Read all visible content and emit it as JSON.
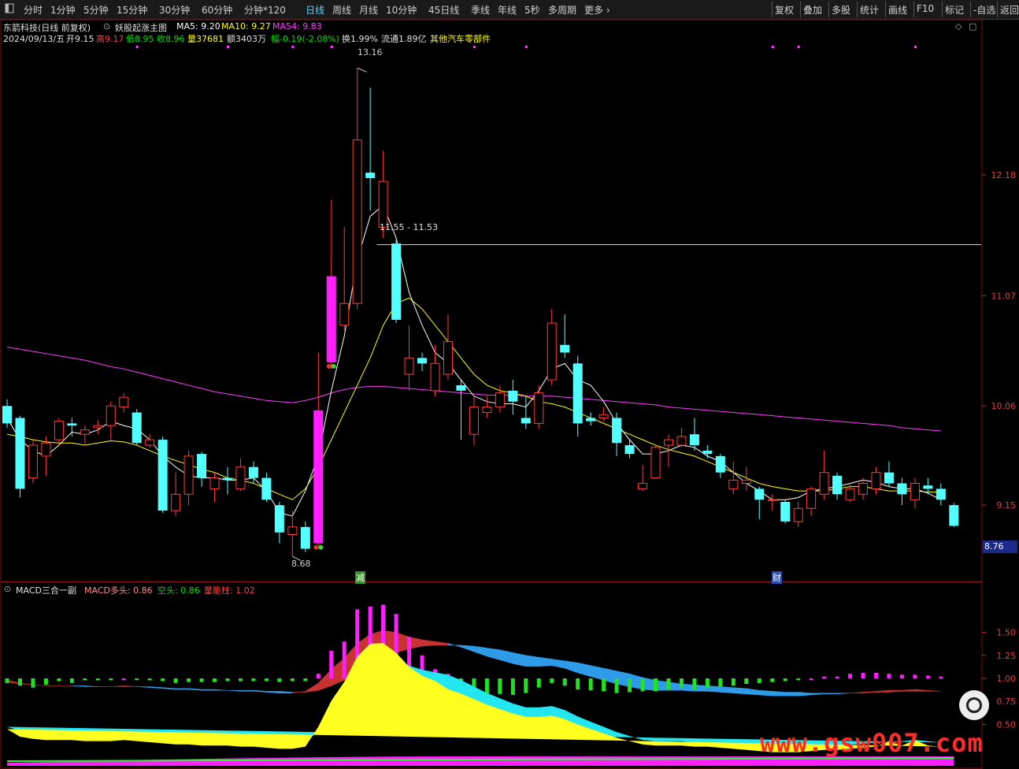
{
  "toolbar": {
    "left_icon": "panel-toggle-icon",
    "periods": [
      "分时",
      "1分钟",
      "5分钟",
      "15分钟",
      "30分钟",
      "60分钟",
      "分钟*120",
      "日线",
      "周线",
      "月线",
      "10分钟",
      "45日线",
      "季线",
      "年线",
      "5秒",
      "多周期",
      "更多"
    ],
    "active_period": "日线",
    "right": [
      "复权",
      "叠加",
      "多股",
      "统计",
      "画线",
      "F10",
      "标记",
      "-自选",
      "返回"
    ]
  },
  "header": {
    "stock": "东箭科技(日线 前复权)",
    "indicator_name": "妖股起涨主图",
    "ma5": "MA5: 9.20",
    "ma10": "MA10: 9.27",
    "ma54": "MA54: 9.83",
    "date": "2024/09/13/五",
    "open": "开9.15",
    "high": "高9.17",
    "low": "低8.95",
    "close": "收8.96",
    "vol": "量37681",
    "amount": "额3403万",
    "change": "幅-0.19(-2.08%)",
    "turnover": "换1.99%",
    "float": "流通1.89亿",
    "sector": "其他汽车零部件"
  },
  "price_labels": {
    "high": "13.16",
    "low": "8.68",
    "range": "11.55 - 11.53",
    "current": "8.76"
  },
  "markers": {
    "jian": "减",
    "cai": "财"
  },
  "sub_header": {
    "name": "MACD三合一副",
    "duo": "MACD多头: 0.86",
    "kong": "空头: 0.86",
    "liang": "量能柱: 1.02"
  },
  "colors": {
    "up": "#ff3c3c",
    "down": "#54ffff",
    "ma5": "#ffffff",
    "ma10": "#ffff00",
    "ma54": "#ff3cff"
  },
  "chart_data": [
    {
      "type": "candlestick",
      "title": "东箭科技(日线 前复权)",
      "y_ticks": [
        12.18,
        11.07,
        10.06,
        9.15
      ],
      "ylim": [
        8.45,
        13.35
      ],
      "candles": [
        [
          10.06,
          9.9,
          10.12,
          9.86
        ],
        [
          9.95,
          9.3,
          9.97,
          9.22
        ],
        [
          9.4,
          9.7,
          9.75,
          9.35
        ],
        [
          9.6,
          9.72,
          9.78,
          9.42
        ],
        [
          9.75,
          9.92,
          9.95,
          9.7
        ],
        [
          9.9,
          9.88,
          9.95,
          9.78
        ],
        [
          9.8,
          9.84,
          9.88,
          9.7
        ],
        [
          9.86,
          9.88,
          9.93,
          9.8
        ],
        [
          9.88,
          10.06,
          10.1,
          9.75
        ],
        [
          10.05,
          10.14,
          10.18,
          10.0
        ],
        [
          10.0,
          9.72,
          10.03,
          9.7
        ],
        [
          9.7,
          9.75,
          9.8,
          9.68
        ],
        [
          9.75,
          9.1,
          9.78,
          9.08
        ],
        [
          9.1,
          9.25,
          9.45,
          9.05
        ],
        [
          9.25,
          9.6,
          9.65,
          9.15
        ],
        [
          9.62,
          9.4,
          9.64,
          9.32
        ],
        [
          9.3,
          9.4,
          9.45,
          9.18
        ],
        [
          9.4,
          9.38,
          9.5,
          9.25
        ],
        [
          9.3,
          9.5,
          9.58,
          9.28
        ],
        [
          9.5,
          9.4,
          9.55,
          9.35
        ],
        [
          9.4,
          9.2,
          9.45,
          9.18
        ],
        [
          9.15,
          8.9,
          9.18,
          8.8
        ],
        [
          8.88,
          8.95,
          9.1,
          8.68
        ],
        [
          8.95,
          8.75,
          9.0,
          8.72
        ],
        [
          8.8,
          10.02,
          10.55,
          8.78
        ],
        [
          10.46,
          11.25,
          11.95,
          10.4
        ],
        [
          10.8,
          11.0,
          11.7,
          10.75
        ],
        [
          11.0,
          12.5,
          13.16,
          10.95
        ],
        [
          12.2,
          12.15,
          12.98,
          11.85
        ],
        [
          11.7,
          12.12,
          12.4,
          11.6
        ],
        [
          11.55,
          10.85,
          11.6,
          10.82
        ],
        [
          10.35,
          10.5,
          10.8,
          10.2
        ],
        [
          10.5,
          10.45,
          10.55,
          10.38
        ],
        [
          10.2,
          10.45,
          10.62,
          10.15
        ],
        [
          10.35,
          10.65,
          10.9,
          10.3
        ],
        [
          10.25,
          10.2,
          10.3,
          9.75
        ],
        [
          9.8,
          10.05,
          10.15,
          9.7
        ],
        [
          10.0,
          10.05,
          10.15,
          9.95
        ],
        [
          10.05,
          10.18,
          10.25,
          10.0
        ],
        [
          10.2,
          10.1,
          10.3,
          9.98
        ],
        [
          9.95,
          9.9,
          10.15,
          9.85
        ],
        [
          9.9,
          10.18,
          10.25,
          9.85
        ],
        [
          10.3,
          10.82,
          10.95,
          10.25
        ],
        [
          10.62,
          10.55,
          10.9,
          10.5
        ],
        [
          10.45,
          9.9,
          10.52,
          9.78
        ],
        [
          9.95,
          9.92,
          10.0,
          9.88
        ],
        [
          9.95,
          9.98,
          10.05,
          9.92
        ],
        [
          9.95,
          9.72,
          10.0,
          9.6
        ],
        [
          9.7,
          9.62,
          9.75,
          9.58
        ],
        [
          9.3,
          9.35,
          9.52,
          9.28
        ],
        [
          9.4,
          9.68,
          9.7,
          9.4
        ],
        [
          9.7,
          9.75,
          9.8,
          9.5
        ],
        [
          9.7,
          9.78,
          9.86,
          9.68
        ],
        [
          9.8,
          9.7,
          9.95,
          9.65
        ],
        [
          9.65,
          9.62,
          9.7,
          9.58
        ],
        [
          9.6,
          9.45,
          9.62,
          9.4
        ],
        [
          9.3,
          9.38,
          9.55,
          9.25
        ],
        [
          9.35,
          9.38,
          9.5,
          9.28
        ],
        [
          9.3,
          9.2,
          9.32,
          9.02
        ],
        [
          9.2,
          9.2,
          9.25,
          9.1
        ],
        [
          9.18,
          9.0,
          9.2,
          8.98
        ],
        [
          9.0,
          9.12,
          9.18,
          8.95
        ],
        [
          9.12,
          9.3,
          9.32,
          9.05
        ],
        [
          9.25,
          9.45,
          9.65,
          9.2
        ],
        [
          9.42,
          9.25,
          9.45,
          9.2
        ],
        [
          9.2,
          9.3,
          9.35,
          9.18
        ],
        [
          9.25,
          9.35,
          9.4,
          9.2
        ],
        [
          9.3,
          9.45,
          9.5,
          9.25
        ],
        [
          9.45,
          9.35,
          9.55,
          9.32
        ],
        [
          9.35,
          9.25,
          9.4,
          9.15
        ],
        [
          9.2,
          9.35,
          9.4,
          9.12
        ],
        [
          9.33,
          9.3,
          9.4,
          9.25
        ],
        [
          9.3,
          9.2,
          9.35,
          9.15
        ],
        [
          9.15,
          8.96,
          9.17,
          8.95
        ]
      ],
      "ma5": [
        9.95,
        9.75,
        9.65,
        9.6,
        9.7,
        9.82,
        9.8,
        9.84,
        9.92,
        9.88,
        9.85,
        9.75,
        9.6,
        9.5,
        9.42,
        9.4,
        9.4,
        9.38,
        9.38,
        9.4,
        9.28,
        9.08,
        9.05,
        9.28,
        9.6,
        10.2,
        10.7,
        11.4,
        11.8,
        11.9,
        11.6,
        11.1,
        10.8,
        10.55,
        10.45,
        10.3,
        10.15,
        10.1,
        10.08,
        10.08,
        10.05,
        10.2,
        10.4,
        10.45,
        10.3,
        10.25,
        10.1,
        9.9,
        9.75,
        9.62,
        9.62,
        9.65,
        9.7,
        9.68,
        9.6,
        9.55,
        9.45,
        9.35,
        9.28,
        9.2,
        9.2,
        9.22,
        9.28,
        9.3,
        9.32,
        9.35,
        9.38,
        9.36,
        9.32,
        9.3,
        9.3,
        9.26,
        9.2
      ],
      "ma10": [
        9.8,
        9.78,
        9.75,
        9.73,
        9.72,
        9.72,
        9.7,
        9.72,
        9.74,
        9.73,
        9.7,
        9.65,
        9.6,
        9.56,
        9.52,
        9.48,
        9.45,
        9.4,
        9.38,
        9.35,
        9.3,
        9.25,
        9.2,
        9.3,
        9.5,
        9.75,
        10.0,
        10.25,
        10.5,
        10.8,
        11.0,
        11.05,
        10.95,
        10.8,
        10.65,
        10.5,
        10.35,
        10.25,
        10.2,
        10.18,
        10.15,
        10.1,
        10.08,
        10.05,
        10.0,
        9.95,
        9.9,
        9.85,
        9.8,
        9.75,
        9.7,
        9.66,
        9.63,
        9.6,
        9.55,
        9.5,
        9.45,
        9.4,
        9.35,
        9.32,
        9.3,
        9.28,
        9.28,
        9.28,
        9.3,
        9.32,
        9.32,
        9.3,
        9.28,
        9.28,
        9.28,
        9.27,
        9.27
      ],
      "ma54": [
        10.6,
        10.58,
        10.56,
        10.54,
        10.52,
        10.5,
        10.48,
        10.45,
        10.42,
        10.4,
        10.37,
        10.34,
        10.31,
        10.28,
        10.25,
        10.22,
        10.19,
        10.17,
        10.15,
        10.13,
        10.11,
        10.1,
        10.09,
        10.11,
        10.14,
        10.18,
        10.21,
        10.23,
        10.24,
        10.24,
        10.23,
        10.22,
        10.21,
        10.2,
        10.19,
        10.18,
        10.17,
        10.16,
        10.16,
        10.16,
        10.15,
        10.15,
        10.15,
        10.14,
        10.13,
        10.12,
        10.11,
        10.1,
        10.09,
        10.08,
        10.07,
        10.05,
        10.04,
        10.03,
        10.02,
        10.01,
        10.0,
        9.99,
        9.98,
        9.97,
        9.96,
        9.95,
        9.94,
        9.93,
        9.92,
        9.91,
        9.9,
        9.89,
        9.88,
        9.86,
        9.85,
        9.84,
        9.83
      ]
    },
    {
      "type": "bar",
      "title": "MACD三合一副",
      "y_ticks": [
        1.5,
        1.25,
        1.0,
        0.75,
        0.5
      ],
      "ylim": [
        0.05,
        1.95
      ],
      "volume_bars": [
        0.95,
        0.92,
        0.9,
        0.93,
        0.97,
        0.95,
        0.98,
        0.98,
        0.98,
        1.0,
        0.99,
        0.98,
        0.97,
        0.95,
        0.96,
        0.96,
        0.96,
        0.97,
        0.97,
        0.97,
        0.97,
        0.96,
        0.97,
        0.97,
        1.05,
        1.3,
        1.4,
        1.75,
        1.78,
        1.8,
        1.7,
        1.45,
        1.25,
        1.1,
        1.05,
        0.96,
        0.85,
        0.82,
        0.83,
        0.82,
        0.84,
        0.9,
        0.95,
        0.92,
        0.88,
        0.87,
        0.86,
        0.84,
        0.85,
        0.86,
        0.86,
        0.88,
        0.9,
        0.88,
        0.9,
        0.91,
        0.92,
        0.94,
        0.95,
        0.96,
        0.97,
        0.98,
        1.0,
        1.02,
        1.02,
        1.05,
        1.06,
        1.06,
        1.05,
        1.04,
        1.04,
        1.03,
        1.02
      ],
      "dif": [
        0.98,
        0.95,
        0.93,
        0.92,
        0.92,
        0.92,
        0.91,
        0.91,
        0.91,
        0.92,
        0.91,
        0.9,
        0.89,
        0.88,
        0.88,
        0.87,
        0.87,
        0.87,
        0.86,
        0.86,
        0.85,
        0.84,
        0.84,
        0.86,
        0.95,
        1.1,
        1.22,
        1.38,
        1.48,
        1.52,
        1.5,
        1.45,
        1.42,
        1.4,
        1.38,
        1.34,
        1.29,
        1.24,
        1.2,
        1.16,
        1.13,
        1.13,
        1.14,
        1.11,
        1.06,
        1.02,
        0.98,
        0.94,
        0.91,
        0.88,
        0.87,
        0.87,
        0.87,
        0.86,
        0.86,
        0.85,
        0.84,
        0.83,
        0.82,
        0.81,
        0.81,
        0.81,
        0.82,
        0.83,
        0.83,
        0.84,
        0.85,
        0.86,
        0.87,
        0.87,
        0.88,
        0.87,
        0.86
      ],
      "dea": [
        0.96,
        0.94,
        0.93,
        0.92,
        0.92,
        0.92,
        0.92,
        0.91,
        0.91,
        0.91,
        0.91,
        0.91,
        0.9,
        0.89,
        0.89,
        0.88,
        0.88,
        0.87,
        0.87,
        0.87,
        0.86,
        0.86,
        0.85,
        0.85,
        0.87,
        0.92,
        0.98,
        1.06,
        1.14,
        1.22,
        1.28,
        1.32,
        1.35,
        1.36,
        1.36,
        1.36,
        1.35,
        1.33,
        1.31,
        1.28,
        1.25,
        1.23,
        1.21,
        1.19,
        1.17,
        1.14,
        1.11,
        1.08,
        1.05,
        1.01,
        0.98,
        0.96,
        0.94,
        0.93,
        0.92,
        0.91,
        0.9,
        0.89,
        0.87,
        0.86,
        0.85,
        0.85,
        0.84,
        0.84,
        0.84,
        0.84,
        0.84,
        0.85,
        0.85,
        0.86,
        0.86,
        0.86,
        0.86
      ]
    }
  ]
}
